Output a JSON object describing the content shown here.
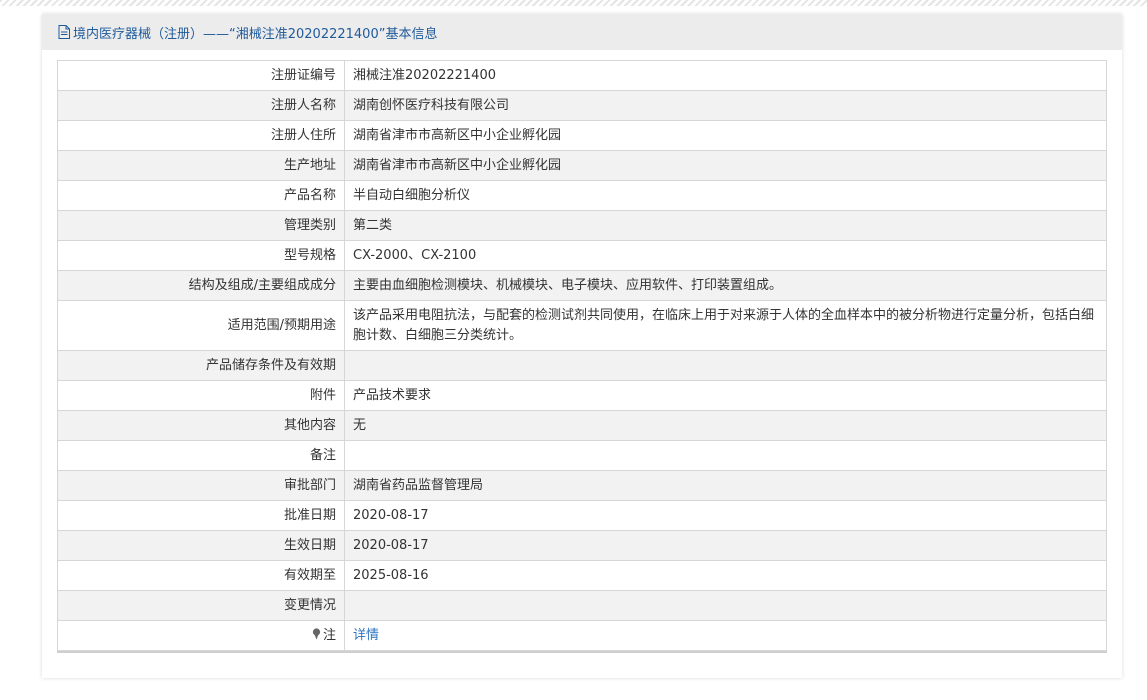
{
  "header": {
    "title": "境内医疗器械（注册）——“湘械注准20202221400”基本信息"
  },
  "rows": [
    {
      "label": "注册证编号",
      "value": "湘械注准20202221400"
    },
    {
      "label": "注册人名称",
      "value": "湖南创怀医疗科技有限公司"
    },
    {
      "label": "注册人住所",
      "value": "湖南省津市市高新区中小企业孵化园"
    },
    {
      "label": "生产地址",
      "value": "湖南省津市市高新区中小企业孵化园"
    },
    {
      "label": "产品名称",
      "value": "半自动白细胞分析仪"
    },
    {
      "label": "管理类别",
      "value": "第二类"
    },
    {
      "label": "型号规格",
      "value": "CX-2000、CX-2100"
    },
    {
      "label": "结构及组成/主要组成成分",
      "value": "主要由血细胞检测模块、机械模块、电子模块、应用软件、打印装置组成。"
    },
    {
      "label": "适用范围/预期用途",
      "value": "该产品采用电阻抗法，与配套的检测试剂共同使用，在临床上用于对来源于人体的全血样本中的被分析物进行定量分析，包括白细胞计数、白细胞三分类统计。"
    },
    {
      "label": "产品储存条件及有效期",
      "value": ""
    },
    {
      "label": "附件",
      "value": "产品技术要求"
    },
    {
      "label": "其他内容",
      "value": "无"
    },
    {
      "label": "备注",
      "value": ""
    },
    {
      "label": "审批部门",
      "value": "湖南省药品监督管理局"
    },
    {
      "label": "批准日期",
      "value": "2020-08-17"
    },
    {
      "label": "生效日期",
      "value": "2020-08-17"
    },
    {
      "label": "有效期至",
      "value": "2025-08-16"
    },
    {
      "label": "变更情况",
      "value": ""
    }
  ],
  "note": {
    "label": "注",
    "link_text": "详情",
    "icon": "pin-icon"
  },
  "colors": {
    "header_text": "#1f5a9a",
    "link": "#2d74c0",
    "row_alt_bg": "#f2f2f2",
    "border": "#d6d6d6"
  }
}
